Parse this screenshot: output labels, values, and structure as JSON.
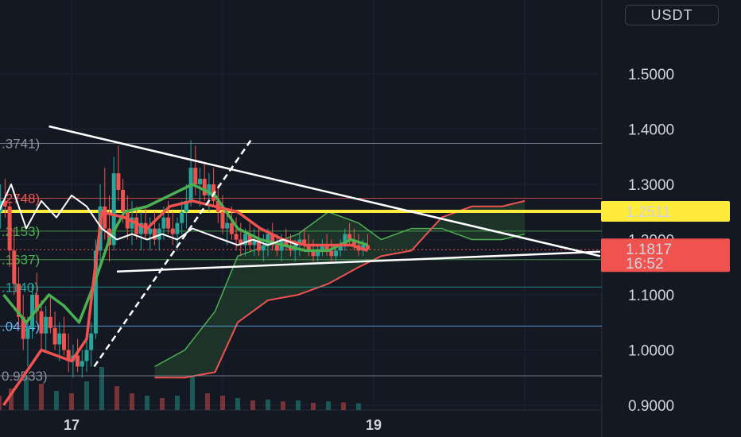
{
  "header": {
    "currency_label": "USDT"
  },
  "chart_data": {
    "type": "candlestick",
    "title": "",
    "ylabel": "USDT",
    "ylim": [
      0.9,
      1.6
    ],
    "yticks": [
      "0.9000",
      "1.0000",
      "1.1000",
      "1.2000",
      "1.3000",
      "1.4000",
      "1.5000"
    ],
    "xticks": [
      {
        "label": "17",
        "day": 17
      },
      {
        "label": "19",
        "day": 19
      }
    ],
    "xlim": [
      16.5,
      20.5
    ],
    "grid": true,
    "fib_levels": [
      {
        "label": ".3741)",
        "value": 1.3741,
        "color": "#8a8f9b"
      },
      {
        "label": ".2748)",
        "value": 1.2748,
        "color": "#ef5350"
      },
      {
        "label": ".2153)",
        "value": 1.2153,
        "color": "#4caf50"
      },
      {
        "label": ".1637)",
        "value": 1.1637,
        "color": "#4caf50"
      },
      {
        "label": ".1140)",
        "value": 1.114,
        "color": "#26a69a"
      },
      {
        "label": ".0434)",
        "value": 1.0434,
        "color": "#64b5f6"
      },
      {
        "label": "0.9533)",
        "value": 0.9533,
        "color": "#8a8f9b"
      }
    ],
    "highlight_level": {
      "value": 1.2511,
      "label": "1.2511",
      "color": "#ffeb3b"
    },
    "last_price": {
      "value": 1.1817,
      "label": "1.1817",
      "countdown": "16:52",
      "color": "#ef5350"
    },
    "trendlines": [
      {
        "from": [
          16.85,
          1.405
        ],
        "to": [
          20.5,
          1.17
        ]
      },
      {
        "from": [
          17.3,
          1.142
        ],
        "to": [
          20.5,
          1.178
        ]
      }
    ],
    "dashed_trendline": {
      "from": [
        17.15,
        0.97
      ],
      "to": [
        18.2,
        1.385
      ]
    },
    "candles": [
      [
        16.5,
        1.2,
        1.28,
        1.16,
        1.25
      ],
      [
        16.53,
        1.25,
        1.3,
        1.22,
        1.27
      ],
      [
        16.56,
        1.27,
        1.31,
        1.24,
        1.26
      ],
      [
        16.59,
        1.26,
        1.27,
        1.15,
        1.18
      ],
      [
        16.62,
        1.18,
        1.22,
        1.1,
        1.12
      ],
      [
        16.65,
        1.12,
        1.15,
        1.04,
        1.06
      ],
      [
        16.68,
        1.06,
        1.1,
        1.0,
        1.02
      ],
      [
        16.71,
        1.02,
        1.06,
        0.97,
        1.04
      ],
      [
        16.74,
        1.04,
        1.12,
        1.02,
        1.1
      ],
      [
        16.77,
        1.1,
        1.14,
        1.05,
        1.07
      ],
      [
        16.8,
        1.07,
        1.09,
        1.0,
        1.03
      ],
      [
        16.83,
        1.03,
        1.08,
        1.0,
        1.06
      ],
      [
        16.86,
        1.06,
        1.1,
        1.03,
        1.04
      ],
      [
        16.89,
        1.04,
        1.07,
        1.0,
        1.01
      ],
      [
        16.92,
        1.01,
        1.05,
        0.98,
        1.03
      ],
      [
        16.95,
        1.03,
        1.06,
        0.99,
        1.0
      ],
      [
        16.98,
        1.0,
        1.03,
        0.96,
        0.98
      ],
      [
        17.01,
        0.98,
        1.01,
        0.95,
        0.99
      ],
      [
        17.04,
        0.99,
        1.02,
        0.96,
        0.97
      ],
      [
        17.07,
        0.97,
        1.0,
        0.95,
        0.98
      ],
      [
        17.1,
        0.98,
        1.02,
        0.96,
        1.0
      ],
      [
        17.13,
        1.0,
        1.05,
        0.97,
        1.03
      ],
      [
        17.16,
        1.03,
        1.2,
        1.02,
        1.18
      ],
      [
        17.19,
        1.18,
        1.3,
        1.15,
        1.26
      ],
      [
        17.22,
        1.26,
        1.33,
        1.2,
        1.22
      ],
      [
        17.25,
        1.22,
        1.28,
        1.16,
        1.19
      ],
      [
        17.28,
        1.19,
        1.35,
        1.18,
        1.32
      ],
      [
        17.31,
        1.32,
        1.37,
        1.27,
        1.29
      ],
      [
        17.34,
        1.29,
        1.31,
        1.23,
        1.25
      ],
      [
        17.37,
        1.25,
        1.28,
        1.2,
        1.22
      ],
      [
        17.4,
        1.22,
        1.27,
        1.19,
        1.24
      ],
      [
        17.43,
        1.24,
        1.26,
        1.2,
        1.21
      ],
      [
        17.46,
        1.21,
        1.25,
        1.18,
        1.23
      ],
      [
        17.49,
        1.23,
        1.26,
        1.2,
        1.21
      ],
      [
        17.52,
        1.21,
        1.24,
        1.18,
        1.22
      ],
      [
        17.55,
        1.22,
        1.25,
        1.19,
        1.2
      ],
      [
        17.58,
        1.2,
        1.23,
        1.18,
        1.22
      ],
      [
        17.61,
        1.22,
        1.26,
        1.2,
        1.24
      ],
      [
        17.64,
        1.24,
        1.27,
        1.21,
        1.22
      ],
      [
        17.67,
        1.22,
        1.25,
        1.19,
        1.21
      ],
      [
        17.7,
        1.21,
        1.24,
        1.18,
        1.23
      ],
      [
        17.73,
        1.23,
        1.27,
        1.21,
        1.25
      ],
      [
        17.76,
        1.25,
        1.3,
        1.22,
        1.27
      ],
      [
        17.79,
        1.27,
        1.38,
        1.26,
        1.33
      ],
      [
        17.82,
        1.33,
        1.37,
        1.28,
        1.3
      ],
      [
        17.85,
        1.3,
        1.33,
        1.26,
        1.31
      ],
      [
        17.88,
        1.31,
        1.34,
        1.27,
        1.28
      ],
      [
        17.91,
        1.28,
        1.32,
        1.25,
        1.3
      ],
      [
        17.94,
        1.3,
        1.33,
        1.26,
        1.27
      ],
      [
        17.97,
        1.27,
        1.3,
        1.23,
        1.25
      ],
      [
        18.0,
        1.25,
        1.28,
        1.21,
        1.22
      ],
      [
        18.03,
        1.22,
        1.25,
        1.19,
        1.23
      ],
      [
        18.06,
        1.23,
        1.26,
        1.2,
        1.21
      ],
      [
        18.09,
        1.21,
        1.24,
        1.18,
        1.2
      ],
      [
        18.12,
        1.2,
        1.23,
        1.17,
        1.19
      ],
      [
        18.15,
        1.19,
        1.22,
        1.17,
        1.21
      ],
      [
        18.18,
        1.21,
        1.23,
        1.18,
        1.19
      ],
      [
        18.21,
        1.19,
        1.22,
        1.17,
        1.2
      ],
      [
        18.24,
        1.2,
        1.22,
        1.17,
        1.18
      ],
      [
        18.27,
        1.18,
        1.21,
        1.16,
        1.19
      ],
      [
        18.3,
        1.19,
        1.22,
        1.17,
        1.21
      ],
      [
        18.33,
        1.21,
        1.23,
        1.18,
        1.19
      ],
      [
        18.36,
        1.19,
        1.21,
        1.17,
        1.18
      ],
      [
        18.39,
        1.18,
        1.21,
        1.16,
        1.2
      ],
      [
        18.42,
        1.2,
        1.22,
        1.18,
        1.19
      ],
      [
        18.45,
        1.19,
        1.21,
        1.17,
        1.18
      ],
      [
        18.48,
        1.18,
        1.2,
        1.16,
        1.19
      ],
      [
        18.51,
        1.19,
        1.21,
        1.17,
        1.2
      ],
      [
        18.54,
        1.2,
        1.22,
        1.18,
        1.19
      ],
      [
        18.57,
        1.19,
        1.21,
        1.17,
        1.18
      ],
      [
        18.6,
        1.18,
        1.2,
        1.16,
        1.17
      ],
      [
        18.63,
        1.17,
        1.19,
        1.16,
        1.18
      ],
      [
        18.66,
        1.18,
        1.2,
        1.17,
        1.19
      ],
      [
        18.69,
        1.19,
        1.21,
        1.17,
        1.18
      ],
      [
        18.72,
        1.18,
        1.2,
        1.16,
        1.17
      ],
      [
        18.75,
        1.17,
        1.19,
        1.16,
        1.18
      ],
      [
        18.78,
        1.18,
        1.2,
        1.17,
        1.19
      ],
      [
        18.81,
        1.19,
        1.22,
        1.18,
        1.21
      ],
      [
        18.84,
        1.21,
        1.23,
        1.19,
        1.2
      ],
      [
        18.87,
        1.2,
        1.22,
        1.18,
        1.19
      ],
      [
        18.9,
        1.19,
        1.21,
        1.17,
        1.18
      ],
      [
        18.93,
        1.18,
        1.2,
        1.17,
        1.19
      ],
      [
        18.96,
        1.19,
        1.21,
        1.18,
        1.182
      ]
    ],
    "series": [
      {
        "name": "",
        "color": "#4caf50",
        "points": [
          [
            16.55,
            1.1
          ],
          [
            16.7,
            1.05
          ],
          [
            16.85,
            1.1
          ],
          [
            16.95,
            1.08
          ],
          [
            17.05,
            1.05
          ],
          [
            17.15,
            1.12
          ],
          [
            17.25,
            1.2
          ],
          [
            17.35,
            1.25
          ],
          [
            17.5,
            1.26
          ],
          [
            17.65,
            1.28
          ],
          [
            17.8,
            1.3
          ],
          [
            17.95,
            1.28
          ],
          [
            18.1,
            1.22
          ],
          [
            18.25,
            1.2
          ],
          [
            18.4,
            1.19
          ],
          [
            18.55,
            1.18
          ],
          [
            18.7,
            1.18
          ],
          [
            18.85,
            1.2
          ],
          [
            18.96,
            1.19
          ]
        ]
      },
      {
        "name": "",
        "color": "#ef5350",
        "points": [
          [
            16.55,
            0.9
          ],
          [
            16.8,
            1.0
          ],
          [
            17.0,
            0.98
          ],
          [
            17.1,
            1.02
          ],
          [
            17.2,
            1.25
          ],
          [
            17.35,
            1.24
          ],
          [
            17.5,
            1.22
          ],
          [
            17.65,
            1.26
          ],
          [
            17.8,
            1.27
          ],
          [
            17.95,
            1.26
          ],
          [
            18.1,
            1.25
          ],
          [
            18.25,
            1.22
          ],
          [
            18.4,
            1.2
          ],
          [
            18.55,
            1.19
          ],
          [
            18.7,
            1.19
          ],
          [
            18.85,
            1.19
          ],
          [
            18.96,
            1.18
          ]
        ]
      },
      {
        "name": "",
        "color": "#ffffff",
        "points": [
          [
            16.5,
            1.24
          ],
          [
            16.6,
            1.3
          ],
          [
            16.7,
            1.22
          ],
          [
            16.8,
            1.27
          ],
          [
            16.9,
            1.24
          ],
          [
            17.0,
            1.28
          ],
          [
            17.1,
            1.26
          ],
          [
            17.2,
            1.22
          ],
          [
            17.3,
            1.2
          ],
          [
            17.4,
            1.21
          ],
          [
            17.5,
            1.2
          ],
          [
            17.6,
            1.21
          ],
          [
            17.7,
            1.2
          ],
          [
            17.8,
            1.22
          ],
          [
            17.9,
            1.21
          ],
          [
            18.0,
            1.2
          ],
          [
            18.1,
            1.19
          ],
          [
            18.2,
            1.2
          ],
          [
            18.3,
            1.19
          ],
          [
            18.4,
            1.2
          ],
          [
            18.5,
            1.19
          ]
        ]
      }
    ],
    "cloud": {
      "span_a": [
        [
          17.55,
          0.97
        ],
        [
          17.75,
          1.0
        ],
        [
          17.95,
          1.07
        ],
        [
          18.1,
          1.17
        ],
        [
          18.3,
          1.19
        ],
        [
          18.5,
          1.21
        ],
        [
          18.7,
          1.25
        ],
        [
          18.9,
          1.23
        ],
        [
          19.05,
          1.2
        ],
        [
          19.25,
          1.22
        ],
        [
          19.45,
          1.22
        ],
        [
          19.65,
          1.2
        ],
        [
          19.85,
          1.2
        ],
        [
          20.0,
          1.21
        ]
      ],
      "span_b": [
        [
          17.55,
          0.95
        ],
        [
          17.75,
          0.95
        ],
        [
          17.95,
          0.96
        ],
        [
          18.1,
          1.05
        ],
        [
          18.3,
          1.09
        ],
        [
          18.5,
          1.1
        ],
        [
          18.7,
          1.12
        ],
        [
          18.9,
          1.15
        ],
        [
          19.05,
          1.17
        ],
        [
          19.25,
          1.18
        ],
        [
          19.45,
          1.24
        ],
        [
          19.65,
          1.26
        ],
        [
          19.85,
          1.26
        ],
        [
          20.0,
          1.27
        ]
      ],
      "fill_bull": "#1f3a2a",
      "fill_bear": "#3a1f24"
    },
    "volume": [
      [
        16.52,
        0.3,
        "#ef5350"
      ],
      [
        16.6,
        0.45,
        "#ef5350"
      ],
      [
        16.7,
        0.7,
        "#26a69a"
      ],
      [
        16.8,
        0.55,
        "#ef5350"
      ],
      [
        16.9,
        0.4,
        "#26a69a"
      ],
      [
        17.0,
        0.35,
        "#ef5350"
      ],
      [
        17.1,
        0.6,
        "#26a69a"
      ],
      [
        17.2,
        0.9,
        "#26a69a"
      ],
      [
        17.3,
        0.5,
        "#ef5350"
      ],
      [
        17.4,
        0.35,
        "#ef5350"
      ],
      [
        17.5,
        0.3,
        "#26a69a"
      ],
      [
        17.6,
        0.25,
        "#ef5350"
      ],
      [
        17.7,
        0.3,
        "#26a69a"
      ],
      [
        17.8,
        0.7,
        "#26a69a"
      ],
      [
        17.9,
        0.35,
        "#ef5350"
      ],
      [
        18.0,
        0.3,
        "#ef5350"
      ],
      [
        18.1,
        0.25,
        "#26a69a"
      ],
      [
        18.2,
        0.2,
        "#ef5350"
      ],
      [
        18.3,
        0.22,
        "#26a69a"
      ],
      [
        18.4,
        0.18,
        "#ef5350"
      ],
      [
        18.5,
        0.2,
        "#26a69a"
      ],
      [
        18.6,
        0.15,
        "#ef5350"
      ],
      [
        18.7,
        0.18,
        "#26a69a"
      ],
      [
        18.8,
        0.16,
        "#ef5350"
      ],
      [
        18.9,
        0.14,
        "#26a69a"
      ]
    ]
  }
}
